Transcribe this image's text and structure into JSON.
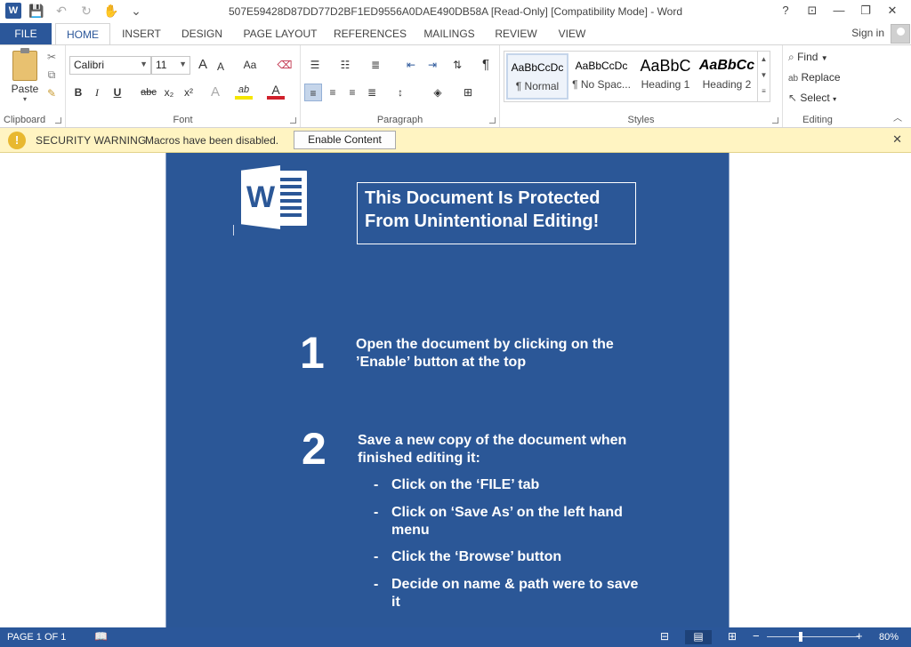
{
  "window": {
    "title": "507E59428D87DD77D2BF1ED9556A0DAE490DB58A [Read-Only] [Compatibility Mode] - Word",
    "help": "?",
    "controls": [
      "⊡",
      "—",
      "❐",
      "✕"
    ]
  },
  "qat": {
    "app_icon": "W",
    "save": "💾",
    "undo": "↶",
    "redo": "↻",
    "touch": "✋",
    "customize": "⌄"
  },
  "tabs": [
    "FILE",
    "HOME",
    "INSERT",
    "DESIGN",
    "PAGE LAYOUT",
    "REFERENCES",
    "MAILINGS",
    "REVIEW",
    "VIEW"
  ],
  "signin": "Sign in",
  "ribbon": {
    "clipboard": {
      "label": "Clipboard",
      "paste": "Paste"
    },
    "font": {
      "label": "Font",
      "name": "Calibri",
      "size": "11",
      "grow": "A",
      "shrink": "A",
      "case": "Aa",
      "bold": "B",
      "italic": "I",
      "underline": "U",
      "strike": "abc",
      "sub": "x₂",
      "sup": "x²",
      "effects": "A",
      "highlight": "ab",
      "color": "A"
    },
    "paragraph": {
      "label": "Paragraph",
      "pilcrow": "¶"
    },
    "styles": {
      "label": "Styles",
      "items": [
        {
          "preview": "AaBbCcDc",
          "name": "¶ Normal"
        },
        {
          "preview": "AaBbCcDc",
          "name": "¶ No Spac..."
        },
        {
          "preview": "AaBbC",
          "name": "Heading 1"
        },
        {
          "preview": "AaBbCc",
          "name": "Heading 2"
        }
      ]
    },
    "editing": {
      "label": "Editing",
      "find": "Find",
      "replace": "Replace",
      "select": "Select"
    }
  },
  "security": {
    "title": "SECURITY WARNING",
    "message": "Macros have been disabled.",
    "button": "Enable Content",
    "close": "✕"
  },
  "document": {
    "logo_letter": "W",
    "protected_line1": "This Document Is Protected",
    "protected_line2": "From Unintentional Editing!",
    "step1_num": "1",
    "step1_line1": "Open the document by clicking on the",
    "step1_line2": "’Enable’ button at the top",
    "step2_num": "2",
    "step2_line1": "Save a new copy of the document when",
    "step2_line2": "finished editing it:",
    "bullets": [
      {
        "l1": "Click on the ‘FILE’ tab",
        "l2": ""
      },
      {
        "l1": "Click on ‘Save As’ on the left hand",
        "l2": "menu"
      },
      {
        "l1": "Click the ‘Browse’ button",
        "l2": ""
      },
      {
        "l1": "Decide on name & path were to save",
        "l2": "it"
      }
    ],
    "dash": "-"
  },
  "status": {
    "page": "PAGE 1 OF 1",
    "zoom": "80%",
    "minus": "−",
    "plus": "+"
  },
  "colors": {
    "accent": "#2b579a",
    "page": "#2b5797",
    "warning_bar": "#fff4c2"
  }
}
